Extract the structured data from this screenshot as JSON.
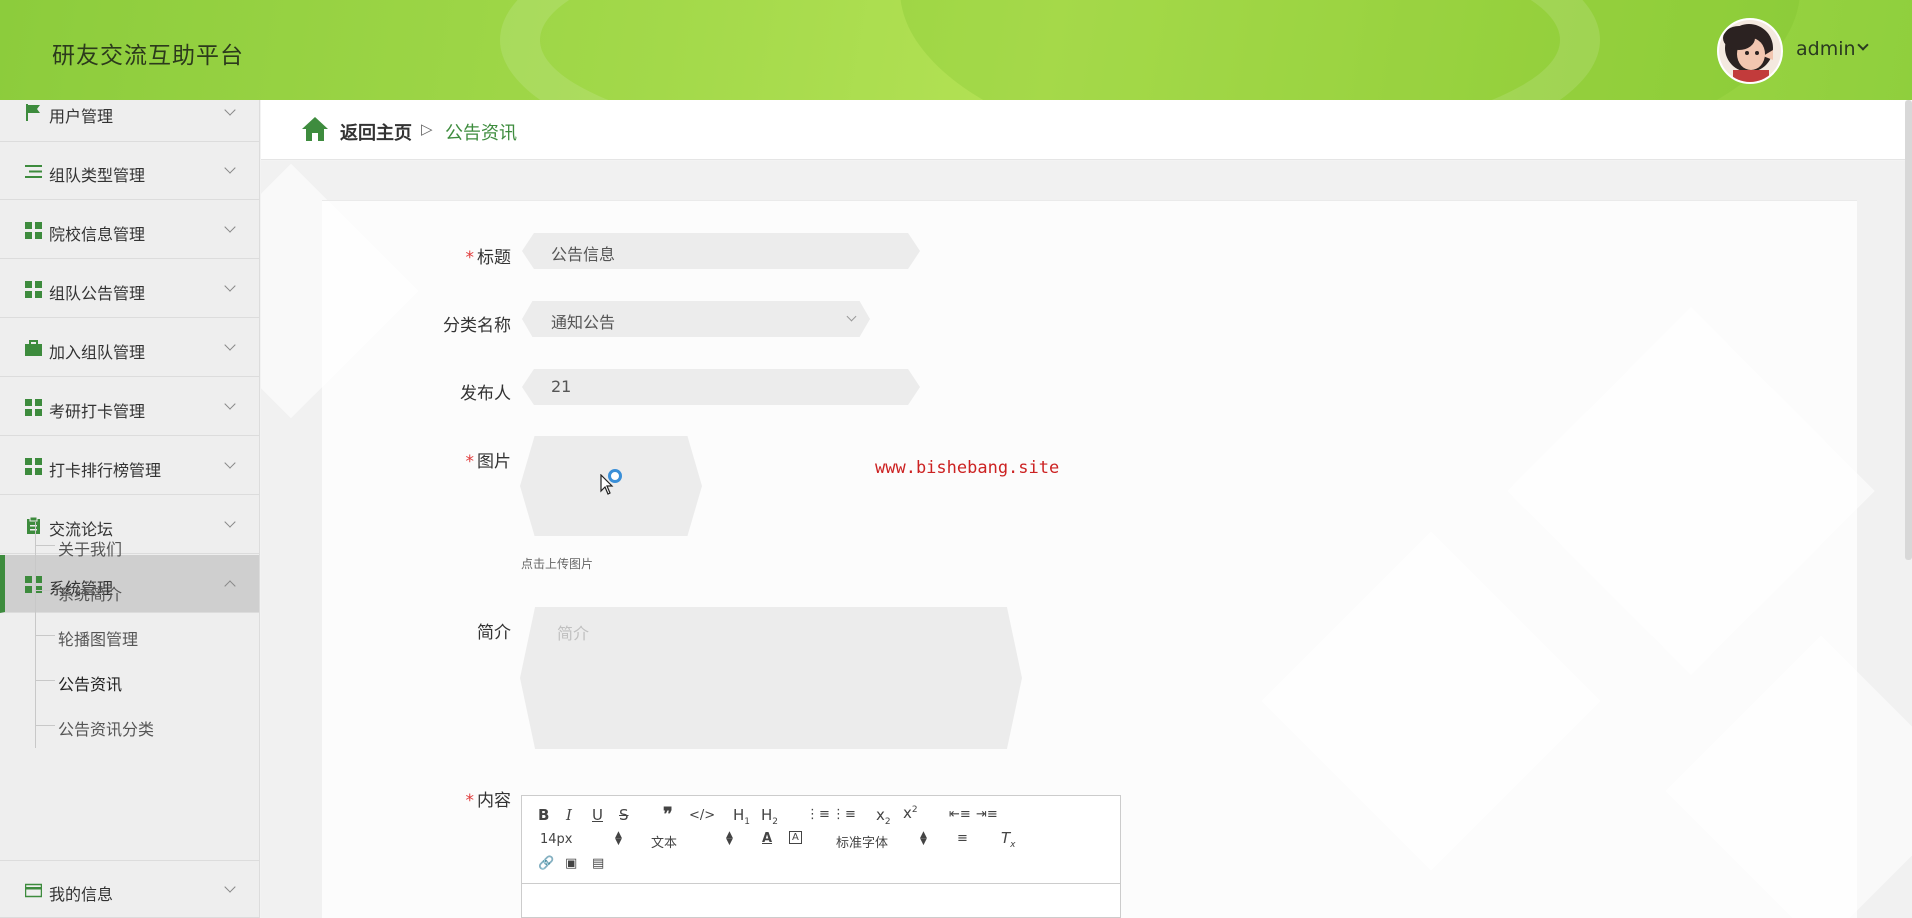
{
  "header": {
    "site_title": "研友交流互助平台",
    "user_name": "admin"
  },
  "sidebar": {
    "items": [
      {
        "label": "用户管理",
        "icon": "flag-icon"
      },
      {
        "label": "组队类型管理",
        "icon": "list-icon"
      },
      {
        "label": "院校信息管理",
        "icon": "grid-icon"
      },
      {
        "label": "组队公告管理",
        "icon": "grid-icon"
      },
      {
        "label": "加入组队管理",
        "icon": "briefcase-icon"
      },
      {
        "label": "考研打卡管理",
        "icon": "grid-icon"
      },
      {
        "label": "打卡排行榜管理",
        "icon": "grid-icon"
      },
      {
        "label": "交流论坛",
        "icon": "clipboard-icon"
      },
      {
        "label": "系统管理",
        "icon": "grid-icon",
        "expanded": true
      },
      {
        "label": "我的信息",
        "icon": "card-icon"
      }
    ],
    "sub_items": [
      {
        "label": "关于我们"
      },
      {
        "label": "系统简介"
      },
      {
        "label": "轮播图管理"
      },
      {
        "label": "公告资讯",
        "active": true
      },
      {
        "label": "公告资讯分类"
      }
    ]
  },
  "breadcrumb": {
    "home": "返回主页",
    "separator": "▷",
    "current": "公告资讯"
  },
  "form": {
    "title_label": "标题",
    "title_value": "公告信息",
    "category_label": "分类名称",
    "category_value": "通知公告",
    "publisher_label": "发布人",
    "publisher_value": "21",
    "image_label": "图片",
    "upload_hint": "点击上传图片",
    "intro_label": "简介",
    "intro_placeholder": "简介",
    "content_label": "内容",
    "required_mark": "*"
  },
  "editor": {
    "font_size": "14px",
    "text_type": "文本",
    "font_family": "标准字体"
  },
  "watermark": "www.bishebang.site",
  "colors": {
    "accent": "#3e8c3e",
    "header": "#a3d94a",
    "required": "#e03b3b"
  }
}
